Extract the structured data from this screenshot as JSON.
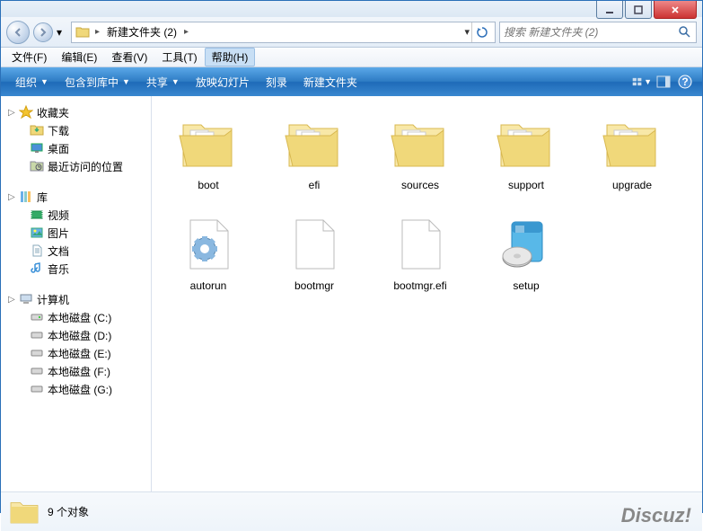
{
  "window": {
    "title": "新建文件夹 (2)"
  },
  "nav": {
    "breadcrumb": [
      "新建文件夹 (2)"
    ],
    "search_placeholder": "搜索 新建文件夹 (2)"
  },
  "menu": {
    "items": [
      "文件(F)",
      "编辑(E)",
      "查看(V)",
      "工具(T)",
      "帮助(H)"
    ],
    "active_index": 4
  },
  "toolbar": {
    "organize": "组织",
    "include": "包含到库中",
    "share": "共享",
    "slideshow": "放映幻灯片",
    "burn": "刻录",
    "newfolder": "新建文件夹"
  },
  "sidebar": {
    "favorites": {
      "label": "收藏夹",
      "items": [
        "下载",
        "桌面",
        "最近访问的位置"
      ]
    },
    "libraries": {
      "label": "库",
      "items": [
        "视频",
        "图片",
        "文档",
        "音乐"
      ]
    },
    "computer": {
      "label": "计算机",
      "items": [
        "本地磁盘 (C:)",
        "本地磁盘 (D:)",
        "本地磁盘 (E:)",
        "本地磁盘 (F:)",
        "本地磁盘 (G:)"
      ]
    }
  },
  "files": [
    {
      "name": "boot",
      "type": "folder-open"
    },
    {
      "name": "efi",
      "type": "folder-open"
    },
    {
      "name": "sources",
      "type": "folder-open"
    },
    {
      "name": "support",
      "type": "folder-open"
    },
    {
      "name": "upgrade",
      "type": "folder-open"
    },
    {
      "name": "autorun",
      "type": "config"
    },
    {
      "name": "bootmgr",
      "type": "file"
    },
    {
      "name": "bootmgr.efi",
      "type": "file"
    },
    {
      "name": "setup",
      "type": "installer"
    }
  ],
  "status": {
    "count_text": "9 个对象"
  },
  "watermark": "Discuz!"
}
